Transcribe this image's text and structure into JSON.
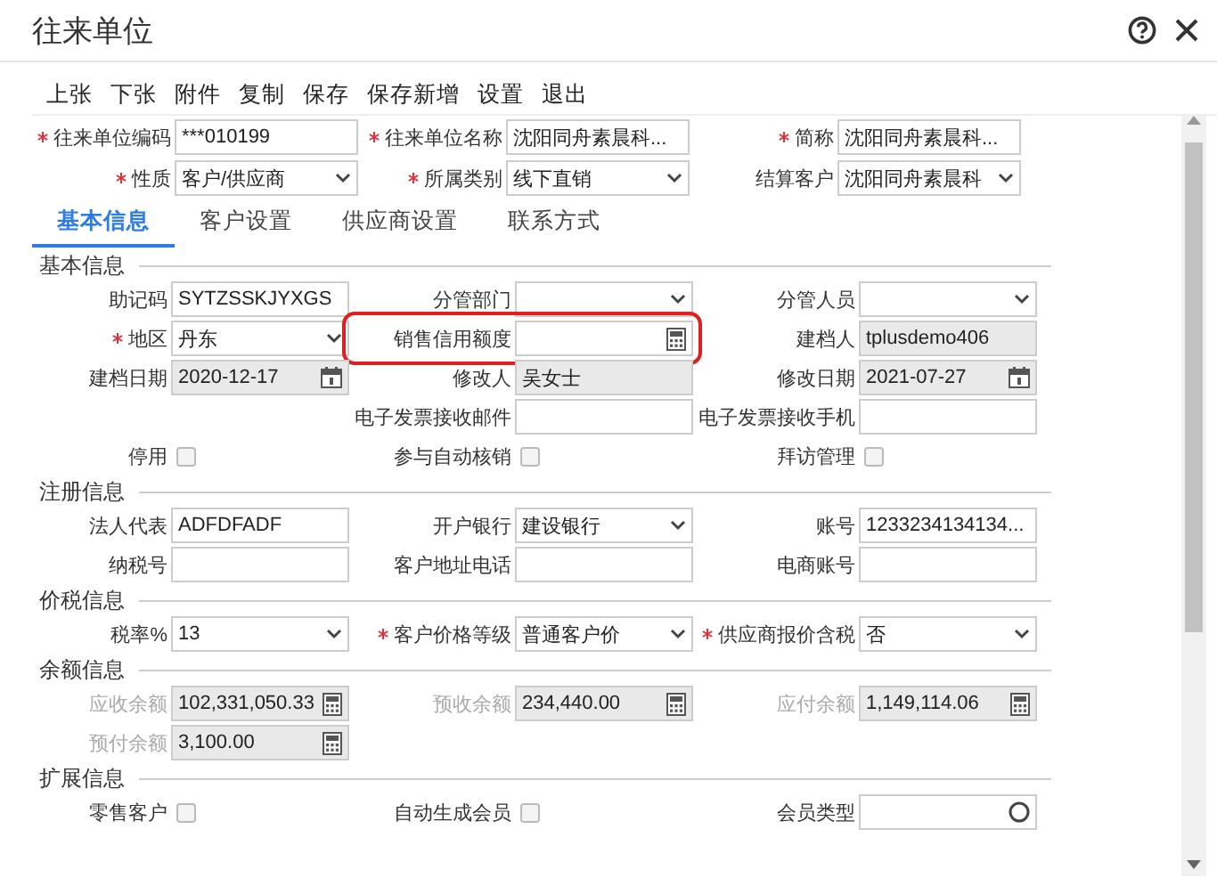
{
  "window": {
    "title": "往来单位"
  },
  "toolbar": [
    "上张",
    "下张",
    "附件",
    "复制",
    "保存",
    "保存新增",
    "设置",
    "退出"
  ],
  "header_rows": [
    [
      {
        "label": "往来单位编码",
        "required": true,
        "kind": "text",
        "value": "***010199"
      },
      {
        "label": "往来单位名称",
        "required": true,
        "kind": "text",
        "value": "沈阳同舟素晨科..."
      },
      {
        "label": "简称",
        "required": true,
        "kind": "text",
        "value": "沈阳同舟素晨科..."
      }
    ],
    [
      {
        "label": "性质",
        "required": true,
        "kind": "select",
        "value": "客户/供应商"
      },
      {
        "label": "所属类别",
        "required": true,
        "kind": "select",
        "value": "线下直销"
      },
      {
        "label": "结算客户",
        "kind": "select",
        "value": "沈阳同舟素晨科"
      }
    ]
  ],
  "tabs": [
    {
      "label": "基本信息",
      "selected": true
    },
    {
      "label": "客户设置",
      "selected": false
    },
    {
      "label": "供应商设置",
      "selected": false
    },
    {
      "label": "联系方式",
      "selected": false
    }
  ],
  "sections": [
    {
      "title": "基本信息",
      "rows": [
        [
          {
            "label": "助记码",
            "kind": "text",
            "value": "SYTZSSKJYXGS"
          },
          {
            "label": "分管部门",
            "kind": "select"
          },
          {
            "label": "分管人员",
            "kind": "select"
          }
        ],
        [
          {
            "label": "地区",
            "required": true,
            "kind": "select",
            "value": "丹东"
          },
          {
            "label": "销售信用额度",
            "kind": "calc",
            "highlighted": true
          },
          {
            "label": "建档人",
            "kind": "text",
            "value": "tplusdemo406",
            "readonly": true
          }
        ],
        [
          {
            "label": "建档日期",
            "kind": "date",
            "value": "2020-12-17",
            "readonly": true
          },
          {
            "label": "修改人",
            "kind": "text",
            "value": "吴女士",
            "readonly": true
          },
          {
            "label": "修改日期",
            "kind": "date",
            "value": "2021-07-27",
            "readonly": true
          }
        ],
        [
          {
            "kind": "spacer"
          },
          {
            "label": "电子发票接收邮件",
            "kind": "text"
          },
          {
            "label": "电子发票接收手机",
            "kind": "text"
          }
        ],
        [
          {
            "label": "停用",
            "kind": "checkbox",
            "checked": false
          },
          {
            "label": "参与自动核销",
            "kind": "checkbox",
            "checked": false
          },
          {
            "label": "拜访管理",
            "kind": "checkbox",
            "checked": false
          }
        ]
      ]
    },
    {
      "title": "注册信息",
      "rows": [
        [
          {
            "label": "法人代表",
            "kind": "text",
            "value": "ADFDFADF"
          },
          {
            "label": "开户银行",
            "kind": "select",
            "value": "建设银行"
          },
          {
            "label": "账号",
            "kind": "text",
            "value": "1233234134134..."
          }
        ],
        [
          {
            "label": "纳税号",
            "kind": "text"
          },
          {
            "label": "客户地址电话",
            "kind": "text"
          },
          {
            "label": "电商账号",
            "kind": "text"
          }
        ]
      ]
    },
    {
      "title": "价税信息",
      "rows": [
        [
          {
            "label": "税率%",
            "kind": "select",
            "value": "13"
          },
          {
            "label": "客户价格等级",
            "required": true,
            "kind": "select",
            "value": "普通客户价"
          },
          {
            "label": "供应商报价含税",
            "required": true,
            "kind": "select",
            "value": "否"
          }
        ]
      ]
    },
    {
      "title": "余额信息",
      "rows": [
        [
          {
            "label": "应收余额",
            "kind": "calc",
            "value": "102,331,050.33",
            "disabled": true
          },
          {
            "label": "预收余额",
            "kind": "calc",
            "value": "234,440.00",
            "disabled": true
          },
          {
            "label": "应付余额",
            "kind": "calc",
            "value": "1,149,114.06",
            "disabled": true
          }
        ],
        [
          {
            "label": "预付余额",
            "kind": "calc",
            "value": "3,100.00",
            "disabled": true
          }
        ]
      ]
    },
    {
      "title": "扩展信息",
      "rows": [
        [
          {
            "label": "零售客户",
            "kind": "checkbox",
            "checked": false
          },
          {
            "label": "自动生成会员",
            "kind": "checkbox",
            "checked": false
          },
          {
            "label": "会员类型",
            "kind": "lookup"
          }
        ]
      ]
    }
  ]
}
